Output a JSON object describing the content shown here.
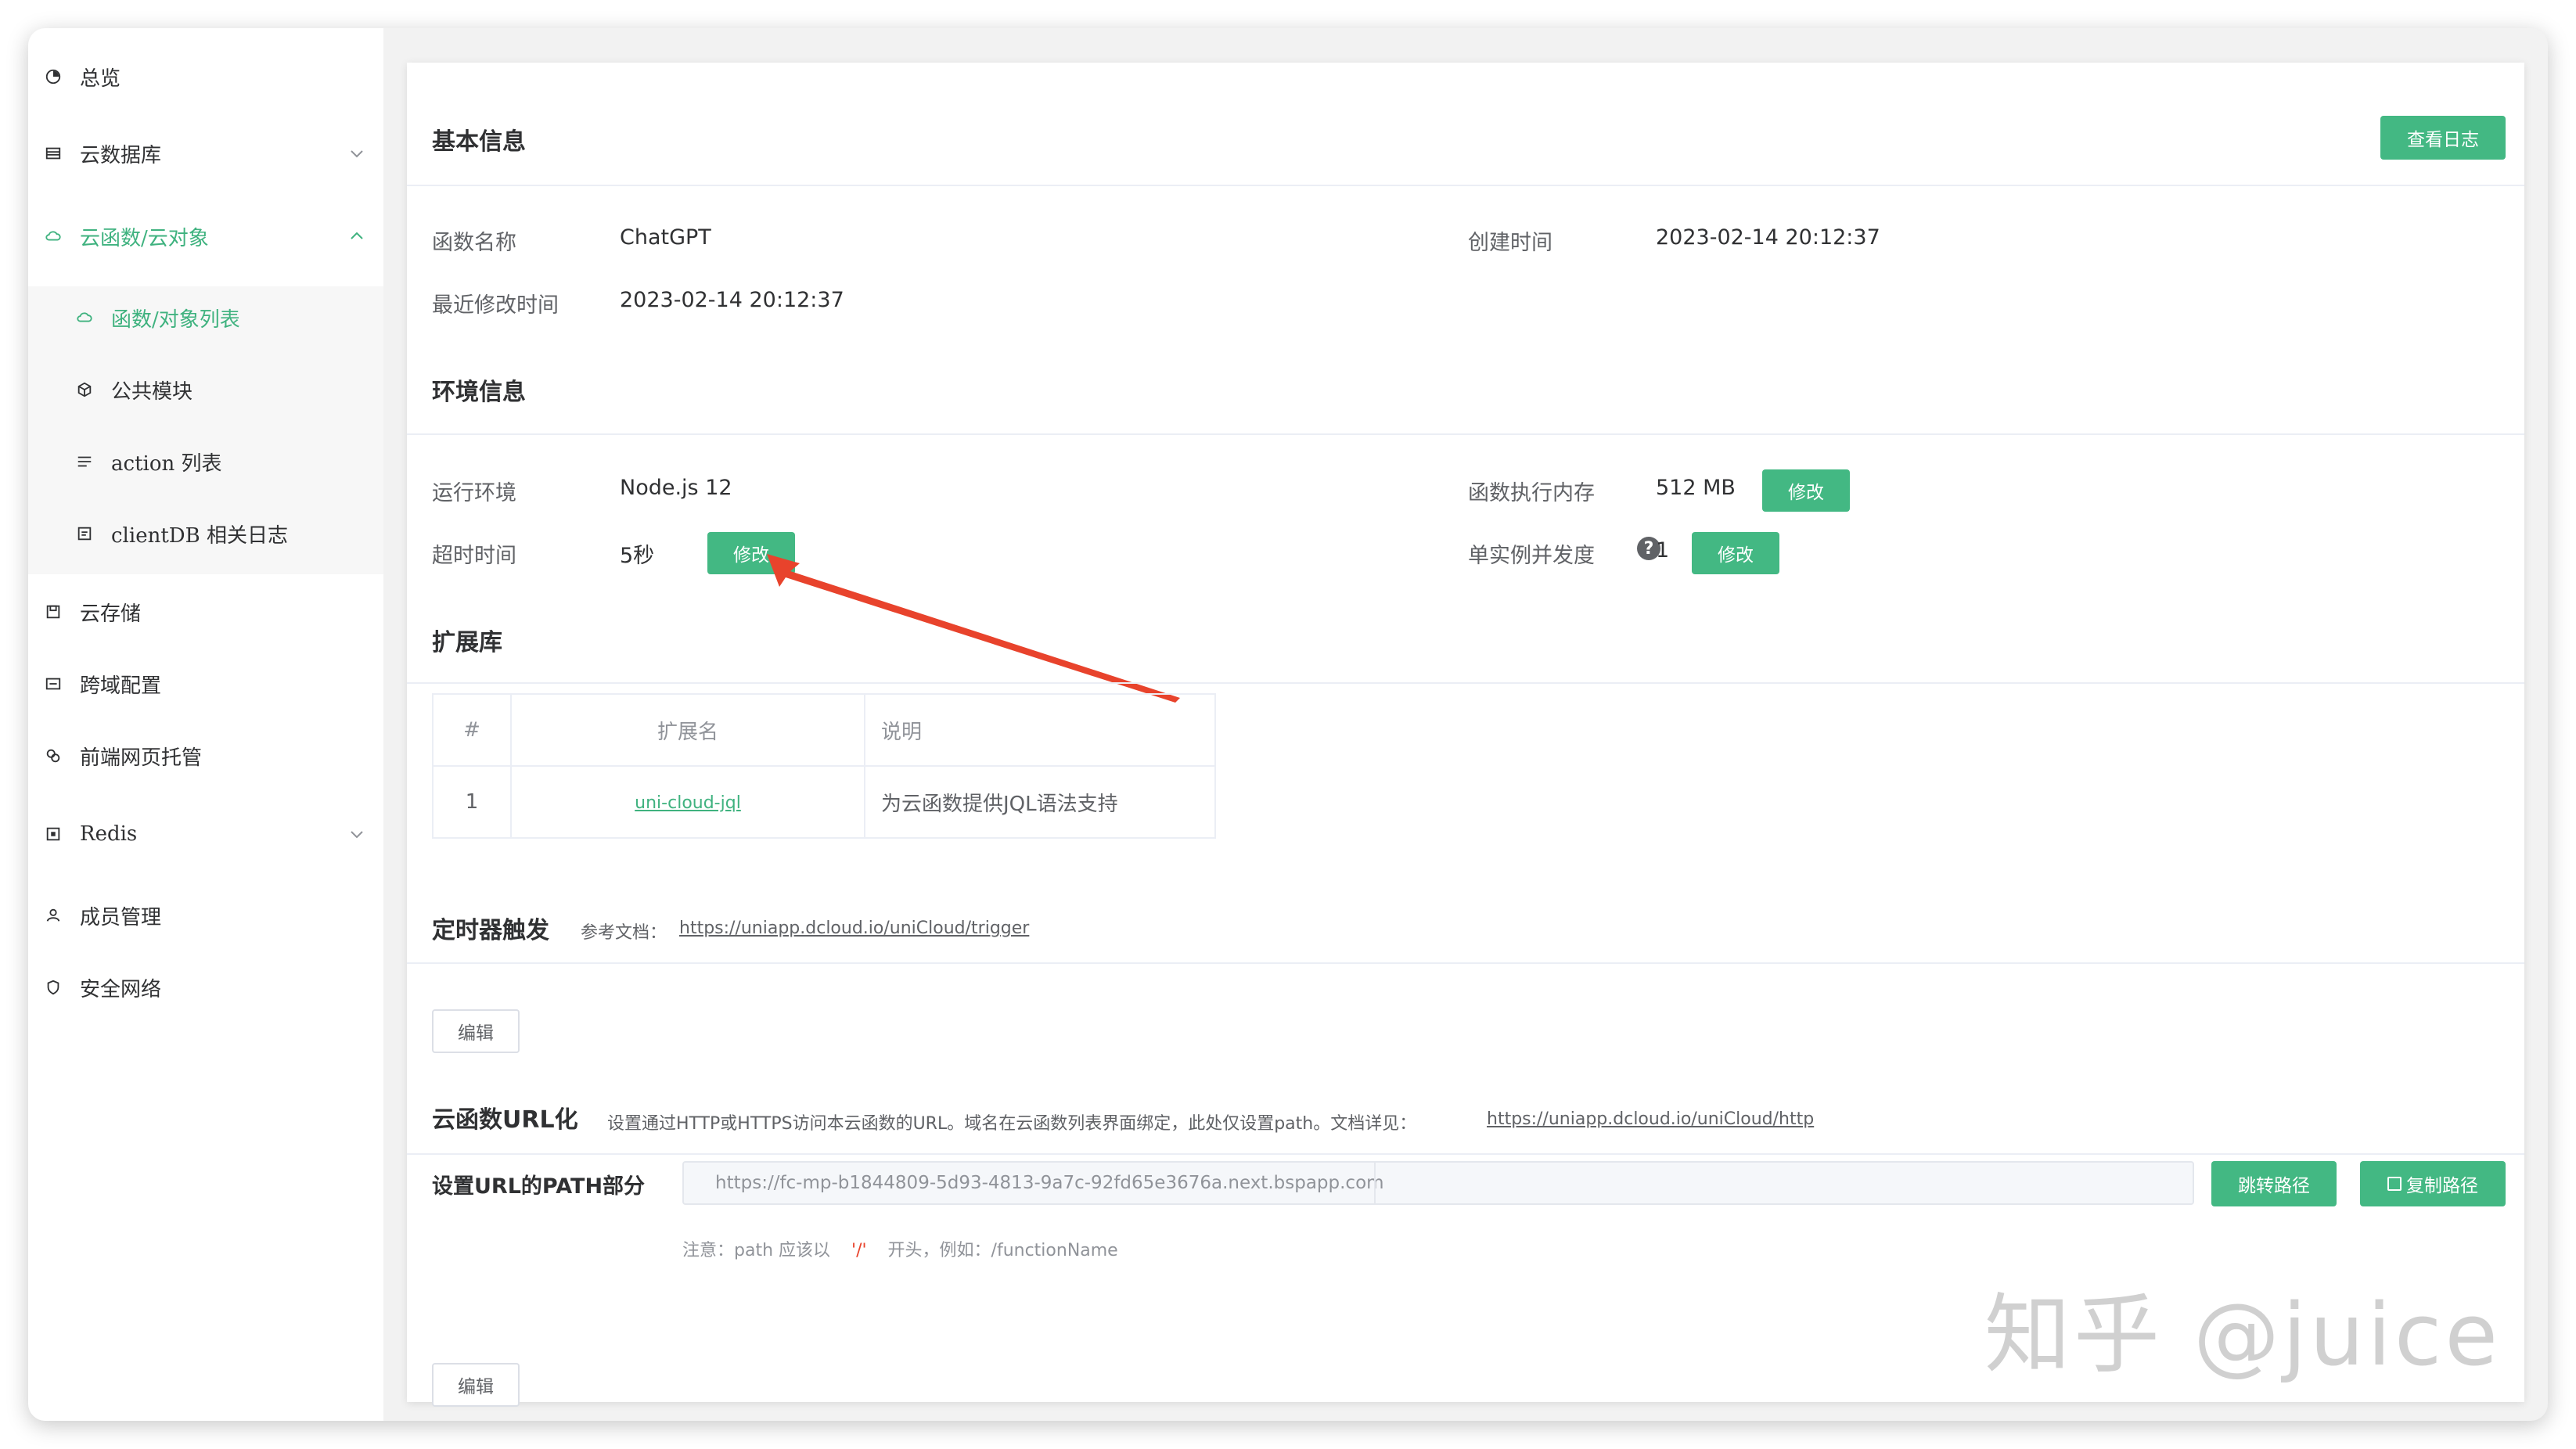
{
  "sidebar": {
    "items": [
      {
        "label": "总览",
        "icon": "dashboard-icon"
      },
      {
        "label": "云数据库",
        "icon": "database-icon"
      },
      {
        "label": "云函数/云对象",
        "icon": "cloud-icon"
      },
      {
        "label": "函数/对象列表",
        "icon": "cloud-icon"
      },
      {
        "label": "公共模块",
        "icon": "cube-icon"
      },
      {
        "label": "action 列表",
        "icon": "list-icon"
      },
      {
        "label": "clientDB 相关日志",
        "icon": "log-icon"
      },
      {
        "label": "云存储",
        "icon": "storage-icon"
      },
      {
        "label": "跨域配置",
        "icon": "cors-icon"
      },
      {
        "label": "前端网页托管",
        "icon": "hosting-icon"
      },
      {
        "label": "Redis",
        "icon": "redis-icon"
      },
      {
        "label": "成员管理",
        "icon": "user-icon"
      },
      {
        "label": "安全网络",
        "icon": "shield-icon"
      }
    ]
  },
  "basic": {
    "title": "基本信息",
    "view_log": "查看日志",
    "name_label": "函数名称",
    "name_value": "ChatGPT",
    "created_label": "创建时间",
    "created_value": "2023-02-14 20:12:37",
    "modified_label": "最近修改时间",
    "modified_value": "2023-02-14 20:12:37"
  },
  "env": {
    "title": "环境信息",
    "runtime_label": "运行环境",
    "runtime_value": "Node.js 12",
    "memory_label": "函数执行内存",
    "memory_value": "512 MB",
    "timeout_label": "超时时间",
    "timeout_value": "5秒",
    "concurrency_label": "单实例并发度",
    "concurrency_value": "1",
    "modify_label": "修改",
    "help_glyph": "?"
  },
  "ext": {
    "title": "扩展库",
    "columns": [
      "#",
      "扩展名",
      "说明"
    ],
    "rows": [
      {
        "index": "1",
        "name": "uni-cloud-jql",
        "desc": "为云函数提供JQL语法支持"
      }
    ]
  },
  "timer": {
    "title": "定时器触发",
    "ref_label": "参考文档：",
    "ref_link": "https://uniapp.dcloud.io/uniCloud/trigger",
    "edit_label": "编辑"
  },
  "url": {
    "title": "云函数URL化",
    "desc": "设置通过HTTP或HTTPS访问本云函数的URL。域名在云函数列表界面绑定，此处仅设置path。文档详见：",
    "doc_link": "https://uniapp.dcloud.io/uniCloud/http",
    "path_label": "设置URL的PATH部分",
    "path_prefix": "https://fc-mp-b1844809-5d93-4813-9a7c-92fd65e3676a.next.bspapp.com",
    "jump_label": "跳转路径",
    "copy_label": "复制路径",
    "note_a": "注意：path 应该以",
    "note_b": "'/'",
    "note_c": "开头，例如：/functionName",
    "edit_label": "编辑"
  },
  "watermark": "知乎 @juice",
  "colors": {
    "accent": "#43b883",
    "arrow": "#e8432c",
    "link": "#2a6fdb"
  }
}
